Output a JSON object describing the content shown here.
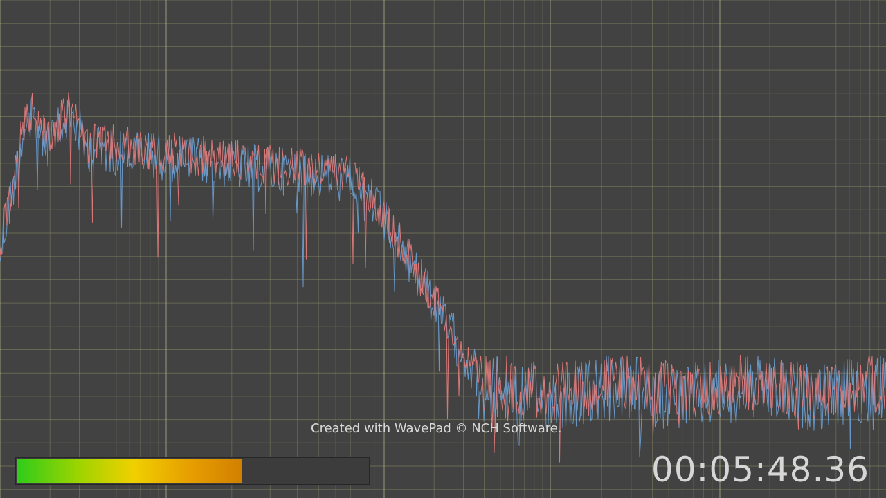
{
  "app": {
    "watermark": "Created with WavePad © NCH Software.",
    "timecode": "00:05:48.36"
  },
  "level_meter": {
    "level": 0.64,
    "colors": [
      "#2ecc19",
      "#f0d000",
      "#d28000"
    ]
  },
  "spectrum": {
    "colors": {
      "background": "#424242",
      "grid": "#8a8a64",
      "grid_major": "#b0b08a",
      "left_channel": "#e07a7a",
      "right_channel": "#6fa6dd"
    }
  }
}
